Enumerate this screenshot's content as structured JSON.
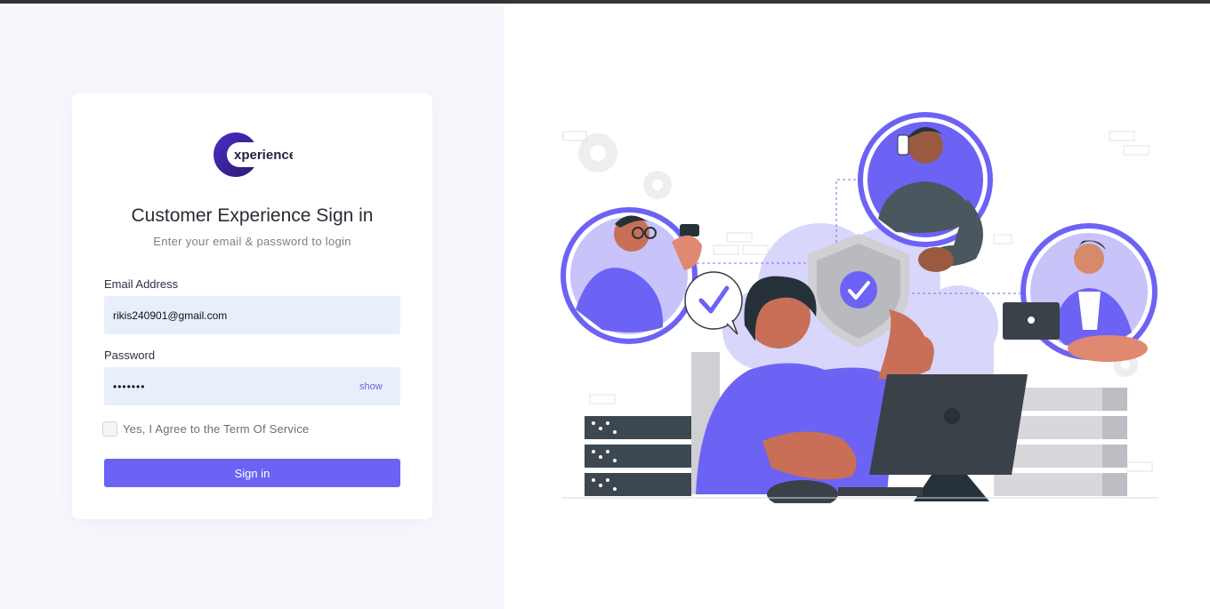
{
  "brand": {
    "logo_text": "xperience",
    "logo_letter": "E"
  },
  "signin": {
    "title": "Customer Experience Sign in",
    "subtitle": "Enter your email & password to login",
    "email_label": "Email Address",
    "email_value": "rikis240901@gmail.com",
    "password_label": "Password",
    "password_value": "•••••••",
    "show_label": "show",
    "agree_label": "Yes, I Agree to the Term Of Service",
    "agree_checked": false,
    "submit_label": "Sign in"
  },
  "colors": {
    "accent": "#6c63f5",
    "input_bg": "#e8effb",
    "page_bg": "#f7f8fd"
  },
  "illustration": {
    "icons": [
      "gear-icon",
      "shield-check-icon",
      "checkmark-bubble-icon",
      "monitor-icon",
      "server-rack-icon",
      "laptop-icon",
      "phone-icon"
    ]
  }
}
